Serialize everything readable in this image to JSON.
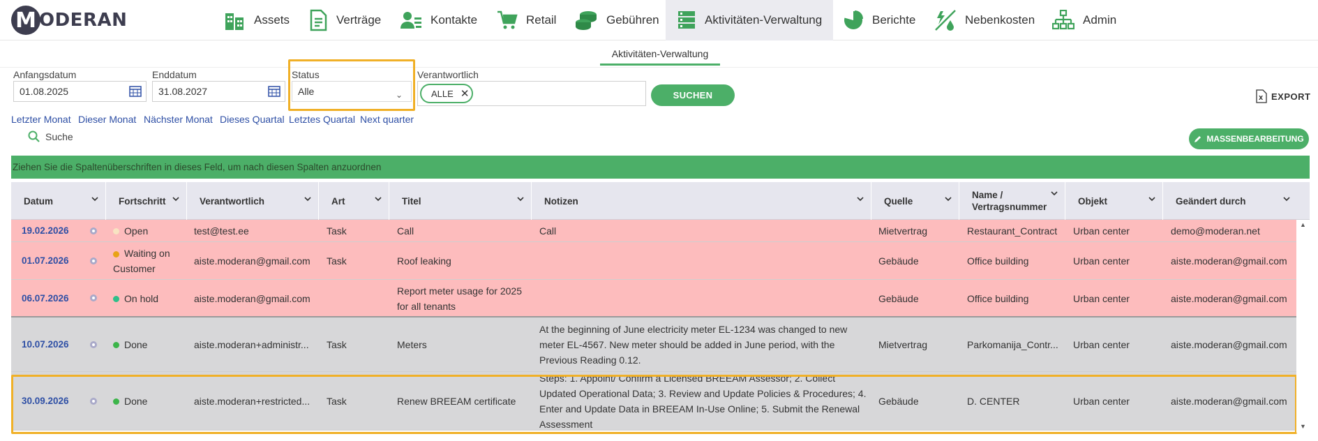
{
  "nav": {
    "logo_letter": "M",
    "logo_text": "ODERAN",
    "items": [
      {
        "label": "Assets",
        "icon": "buildings-icon"
      },
      {
        "label": "Verträge",
        "icon": "document-icon"
      },
      {
        "label": "Kontakte",
        "icon": "contacts-icon"
      },
      {
        "label": "Retail",
        "icon": "cart-icon"
      },
      {
        "label": "Gebühren",
        "icon": "coins-icon"
      },
      {
        "label": "Aktivitäten-Verwaltung",
        "icon": "tasks-icon"
      },
      {
        "label": "Berichte",
        "icon": "pie-chart-icon"
      },
      {
        "label": "Nebenkosten",
        "icon": "utilities-icon"
      },
      {
        "label": "Admin",
        "icon": "org-chart-icon"
      }
    ],
    "active": "Aktivitäten-Verwaltung"
  },
  "subtab": "Aktivitäten-Verwaltung",
  "filters": {
    "start_label": "Anfangsdatum",
    "start_value": "01.08.2025",
    "end_label": "Enddatum",
    "end_value": "31.08.2027",
    "status_label": "Status",
    "status_value": "Alle",
    "responsible_label": "Verantwortlich",
    "responsible_chip": "ALLE",
    "search_button": "SUCHEN",
    "export_label": "EXPORT"
  },
  "quick_ranges": [
    "Letzter Monat",
    "Dieser Monat",
    "Nächster Monat",
    "Dieses Quartal",
    "Letztes Quartal",
    "Next quarter"
  ],
  "search_label": "Suche",
  "bulk_edit_label": "MASSENBEARBEITUNG",
  "group_hint": "Ziehen Sie die Spaltenüberschriften in dieses Feld, um nach diesen Spalten anzuordnen",
  "columns": {
    "datum": "Datum",
    "fortschritt": "Fortschritt",
    "verantwortlich": "Verantwortlich",
    "art": "Art",
    "titel": "Titel",
    "notizen": "Notizen",
    "quelle": "Quelle",
    "name_line1": "Name /",
    "name_line2": "Vertragsnummer",
    "objekt": "Objekt",
    "geaendert": "Geändert durch"
  },
  "colors": {
    "accent": "#4caf68",
    "highlight": "#f0b027",
    "overdue_row": "#fdbcbd",
    "done_row": "#d7d7d9",
    "link": "#2e4fa5"
  },
  "rows": [
    {
      "datum": "19.02.2026",
      "status": "Open",
      "status_color": "#f8e3c2",
      "verantwortlich": "test@test.ee",
      "art": "Task",
      "titel": "Call",
      "notizen": "Call",
      "quelle": "Mietvertrag",
      "name": "Restaurant_Contract",
      "objekt": "Urban center",
      "geaendert": "demo@moderan.net"
    },
    {
      "datum": "01.07.2026",
      "status": "Waiting on Customer",
      "status_color": "#e8a317",
      "verantwortlich": "aiste.moderan@gmail.com",
      "art": "Task",
      "titel": "Roof leaking",
      "notizen": "",
      "quelle": "Gebäude",
      "name": "Office building",
      "objekt": "Urban center",
      "geaendert": "aiste.moderan@gmail.com"
    },
    {
      "datum": "06.07.2026",
      "status": "On hold",
      "status_color": "#2fbf8a",
      "verantwortlich": "aiste.moderan@gmail.com",
      "art": "",
      "titel": "Report meter usage for 2025 for all tenants",
      "notizen": "",
      "quelle": "Gebäude",
      "name": "Office building",
      "objekt": "Urban center",
      "geaendert": "aiste.moderan@gmail.com"
    },
    {
      "datum": "10.07.2026",
      "status": "Done",
      "status_color": "#3cb54a",
      "verantwortlich": "aiste.moderan+administr...",
      "art": "Task",
      "titel": "Meters",
      "notizen": "At the beginning of June electricity meter EL-1234 was changed to new meter EL-4567. New meter should be added in June period, with the Previous Reading 0.12.",
      "quelle": "Mietvertrag",
      "name": "Parkomanija_Contr...",
      "objekt": "Urban center",
      "geaendert": "aiste.moderan@gmail.com"
    },
    {
      "datum": "30.09.2026",
      "status": "Done",
      "status_color": "#3cb54a",
      "verantwortlich": "aiste.moderan+restricted...",
      "art": "Task",
      "titel": "Renew BREEAM certificate",
      "notizen": "Steps: 1. Appoint/ Confirm a Licensed BREEAM Assessor; 2. Collect Updated Operational Data; 3. Review and Update Policies & Procedures; 4. Enter and Update Data in BREEAM In-Use Online; 5. Submit the Renewal Assessment",
      "quelle": "Gebäude",
      "name": "D. CENTER",
      "objekt": "Urban center",
      "geaendert": "aiste.moderan@gmail.com"
    }
  ]
}
